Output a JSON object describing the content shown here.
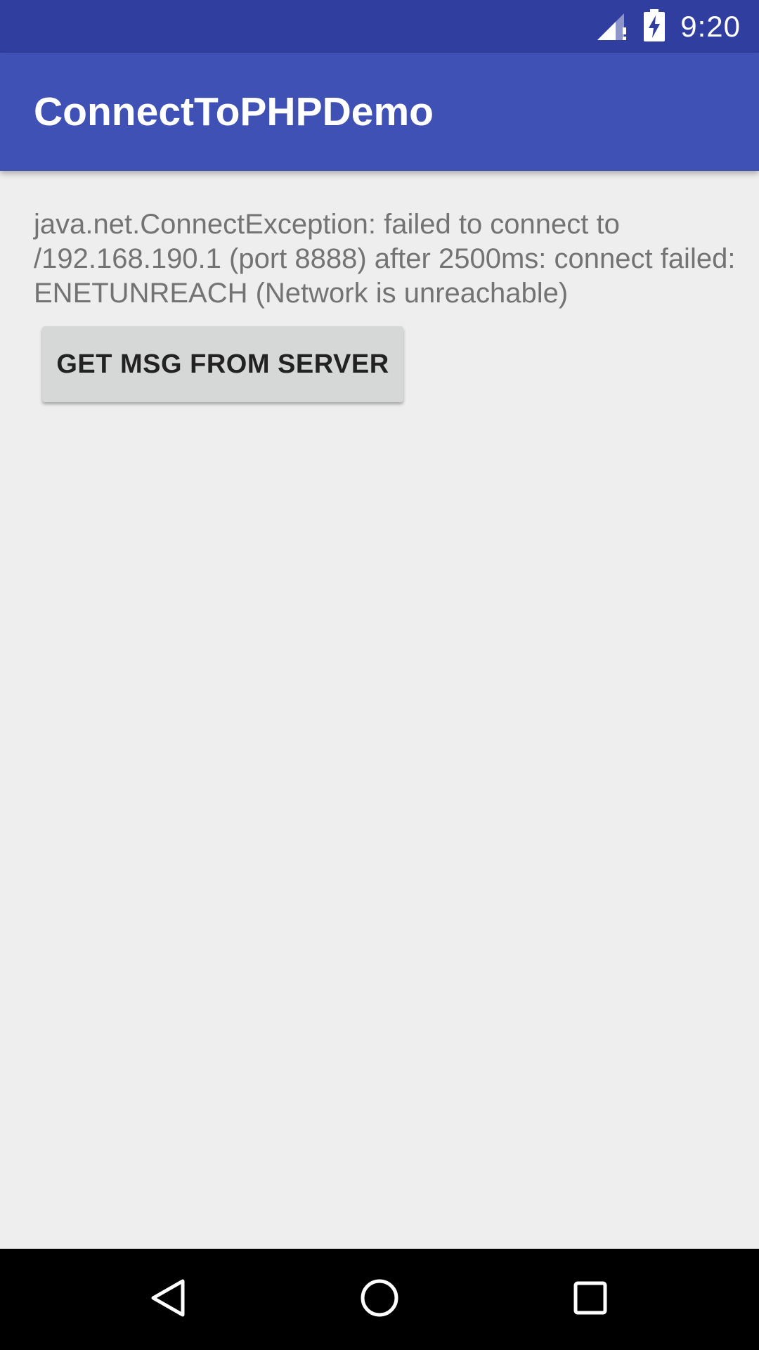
{
  "status_bar": {
    "time": "9:20",
    "icons": [
      "signal-no-data-icon",
      "battery-charging-icon"
    ],
    "background": "#303f9f"
  },
  "app_bar": {
    "title": "ConnectToPHPDemo",
    "background": "#3f51b5"
  },
  "main": {
    "message": "java.net.ConnectException: failed to connect to /192.168.190.1 (port 8888) after 2500ms: connect failed: ENETUNREACH (Network is unreachable)",
    "button_label": "GET MSG FROM SERVER"
  },
  "nav_bar": {
    "icons": [
      "back-icon",
      "home-icon",
      "recents-icon"
    ]
  }
}
